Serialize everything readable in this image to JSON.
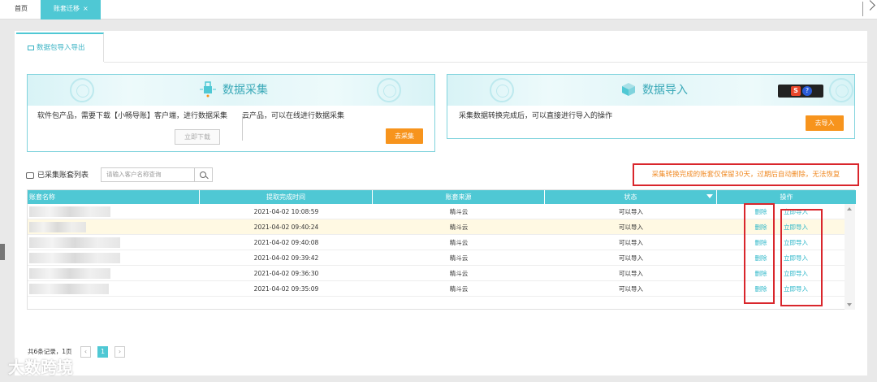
{
  "tabs": {
    "home": "首页",
    "active": "账套迁移",
    "close": "×"
  },
  "subtab": {
    "label": "数据包导入导出"
  },
  "card_collect": {
    "title": "数据采集",
    "desc_left": "软件包产品，需要下载【小畅导账】客户端，进行数据采集",
    "desc_right": "云产品，可以在线进行数据采集",
    "download_btn": "立即下载",
    "collect_btn": "去采集"
  },
  "card_import": {
    "title": "数据导入",
    "desc": "采集数据转换完成后，可以直接进行导入的操作",
    "import_btn": "去导入",
    "toolbar_s": "S",
    "toolbar_q": "?"
  },
  "list": {
    "title": "已采集账套列表",
    "search_placeholder": "请输入客户名称查询",
    "warning": "采集转换完成的账套仅保留30天，过期后自动删除，无法恢复"
  },
  "table": {
    "columns": [
      "账套名称",
      "提取完成时间",
      "账套来源",
      "状态",
      "操作"
    ],
    "rows": [
      {
        "time": "2021-04-02 10:08:59",
        "source": "精斗云",
        "status": "可以导入",
        "del": "删除",
        "imp": "立即导入"
      },
      {
        "time": "2021-04-02 09:40:24",
        "source": "精斗云",
        "status": "可以导入",
        "del": "删除",
        "imp": "立即导入"
      },
      {
        "time": "2021-04-02 09:40:08",
        "source": "精斗云",
        "status": "可以导入",
        "del": "删除",
        "imp": "立即导入"
      },
      {
        "time": "2021-04-02 09:39:42",
        "source": "精斗云",
        "status": "可以导入",
        "del": "删除",
        "imp": "立即导入"
      },
      {
        "time": "2021-04-02 09:36:30",
        "source": "精斗云",
        "status": "可以导入",
        "del": "删除",
        "imp": "立即导入"
      },
      {
        "time": "2021-04-02 09:35:09",
        "source": "精斗云",
        "status": "可以导入",
        "del": "删除",
        "imp": "立即导入"
      }
    ]
  },
  "pager": {
    "summary": "共6条记录，1页",
    "prev": "‹",
    "current": "1",
    "next": "›"
  },
  "watermark": "大数跨境"
}
